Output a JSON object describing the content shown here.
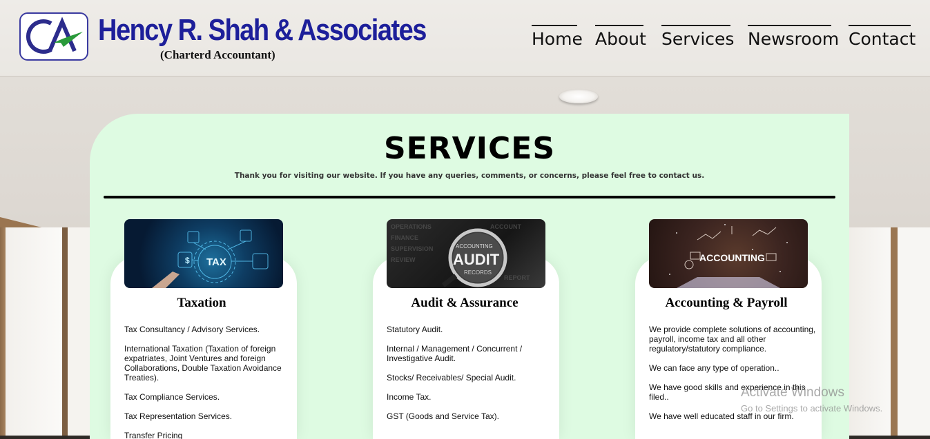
{
  "header": {
    "logo_text": "CA",
    "brand_name": "Hency R. Shah & Associates",
    "brand_sub": "(Charterd Accountant)",
    "nav": [
      "Home",
      "About",
      "Services",
      "Newsroom",
      "Contact"
    ]
  },
  "main": {
    "title": "SERVICES",
    "subtitle": "Thank you for visiting our website. If you have any queries, comments, or concerns, please feel free to contact us.",
    "services": [
      {
        "image_text": "TAX",
        "heading": "Taxation",
        "items": [
          "Tax Consultancy / Advisory Services.",
          "International Taxation (Taxation of foreign expatriates, Joint Ventures and foreign Collaborations, Double Taxation Avoidance Treaties).",
          "Tax Compliance Services.",
          "Tax Representation Services.",
          "Transfer Pricing"
        ]
      },
      {
        "image_text": "AUDIT",
        "heading": "Audit & Assurance",
        "items": [
          "Statutory Audit.",
          "Internal / Management / Concurrent / Investigative Audit.",
          "Stocks/ Receivables/ Special Audit.",
          "Income Tax.",
          "GST (Goods and Service Tax)."
        ]
      },
      {
        "image_text": "ACCOUNTING",
        "heading": "Accounting & Payroll",
        "items": [
          "We provide complete solutions of accounting, payroll, income tax and all other regulatory/statutory compliance.",
          "We can face any type of operation..",
          "We have good skills and experience in this filed..",
          "We have well educated staff in our firm."
        ]
      }
    ]
  },
  "watermark": {
    "line1": "Activate Windows",
    "line2": "Go to Settings to activate Windows."
  },
  "colors": {
    "brand_blue": "#1d1f9a",
    "card_bg": "#defbe2",
    "accent_green": "#2a9a3a"
  }
}
